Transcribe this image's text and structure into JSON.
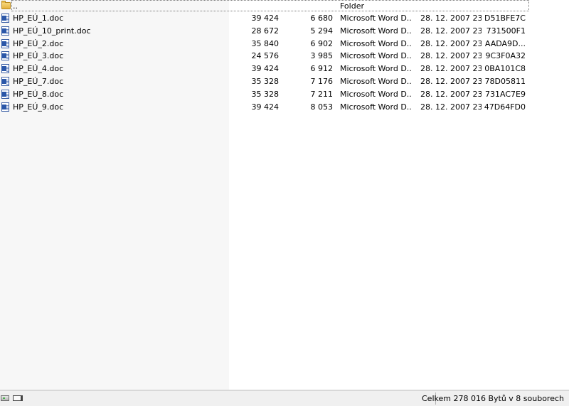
{
  "parent_row": {
    "name": "..",
    "type": "Folder"
  },
  "files": [
    {
      "name": "HP_EÚ_1.doc",
      "size": "39 424",
      "packed": "6 680",
      "type": "Microsoft Word D...",
      "date": "28. 12. 2007 23:...",
      "crc": "D51BFE7C"
    },
    {
      "name": "HP_EÚ_10_print.doc",
      "size": "28 672",
      "packed": "5 294",
      "type": "Microsoft Word D...",
      "date": "28. 12. 2007 23:...",
      "crc": "731500F1"
    },
    {
      "name": "HP_EÚ_2.doc",
      "size": "35 840",
      "packed": "6 902",
      "type": "Microsoft Word D...",
      "date": "28. 12. 2007 23:...",
      "crc": "AADA9D..."
    },
    {
      "name": "HP_EÚ_3.doc",
      "size": "24 576",
      "packed": "3 985",
      "type": "Microsoft Word D...",
      "date": "28. 12. 2007 23:...",
      "crc": "9C3F0A32"
    },
    {
      "name": "HP_EÚ_4.doc",
      "size": "39 424",
      "packed": "6 912",
      "type": "Microsoft Word D...",
      "date": "28. 12. 2007 23:...",
      "crc": "0BA101C8"
    },
    {
      "name": "HP_EÚ_7.doc",
      "size": "35 328",
      "packed": "7 176",
      "type": "Microsoft Word D...",
      "date": "28. 12. 2007 23:...",
      "crc": "78D05811"
    },
    {
      "name": "HP_EÚ_8.doc",
      "size": "35 328",
      "packed": "7 211",
      "type": "Microsoft Word D...",
      "date": "28. 12. 2007 23:...",
      "crc": "731AC7E9"
    },
    {
      "name": "HP_EÚ_9.doc",
      "size": "39 424",
      "packed": "8 053",
      "type": "Microsoft Word D...",
      "date": "28. 12. 2007 23:...",
      "crc": "47D64FD0"
    }
  ],
  "statusbar": {
    "summary": "Celkem 278 016 Bytů v 8 souborech"
  },
  "icons": {
    "parent": "folder-icon",
    "file": "word-document-icon",
    "drive": "drive-icon",
    "network": "network-icon"
  }
}
